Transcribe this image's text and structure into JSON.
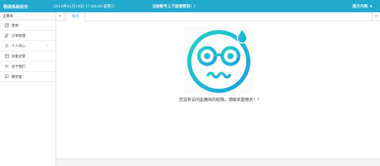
{
  "header": {
    "app_title": "物流系统后台",
    "datetime": "2019年01月16日 17:00:49 星期三",
    "notice": "注册账号上下班请签到！！",
    "user_name": "南方月辉"
  },
  "sidebar": {
    "title": "主菜单",
    "items": [
      {
        "label": "签到",
        "icon": "edit-icon"
      },
      {
        "label": "订单管理",
        "icon": "pencil-icon"
      },
      {
        "label": "个人中心",
        "icon": "user-icon",
        "has_children": true,
        "arrow": "›"
      },
      {
        "label": "资金记录",
        "icon": "wallet-icon"
      },
      {
        "label": "关于我们",
        "icon": "group-icon"
      },
      {
        "label": "聊天室",
        "icon": "chat-icon"
      }
    ]
  },
  "tabs": {
    "prev": "«",
    "next": "»",
    "home_label": "首页"
  },
  "main": {
    "message": "您没有访问此模块的权限。请联系管理员！！"
  },
  "colors": {
    "accent": "#22a9cf",
    "face_gradient_start": "#1fd1c5",
    "face_gradient_end": "#1ea0e0"
  }
}
